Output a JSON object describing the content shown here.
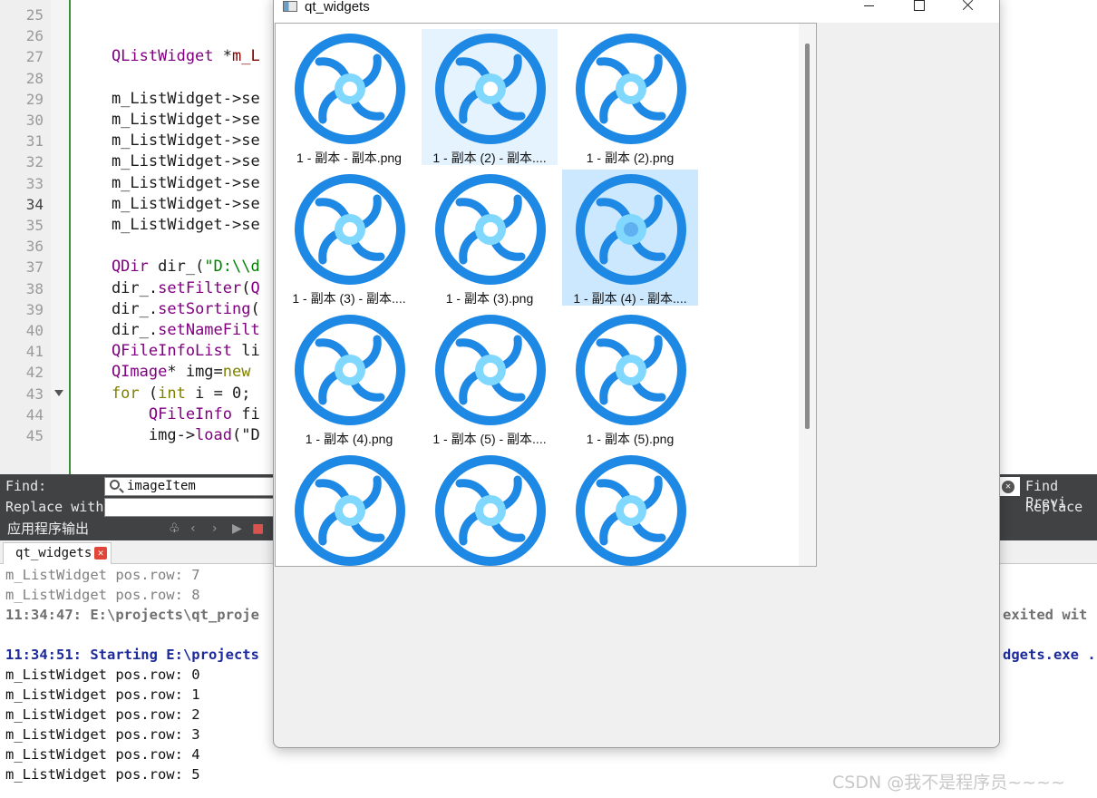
{
  "editor": {
    "lines": [
      {
        "n": "25",
        "segs": []
      },
      {
        "n": "26",
        "segs": []
      },
      {
        "n": "27",
        "segs": [
          {
            "c": "t-type",
            "t": "    QListWidget"
          },
          {
            "c": "",
            "t": " *"
          },
          {
            "c": "t-var",
            "t": "m_L"
          }
        ]
      },
      {
        "n": "28",
        "segs": []
      },
      {
        "n": "29",
        "segs": [
          {
            "c": "",
            "t": "    m_ListWidget->se"
          }
        ]
      },
      {
        "n": "30",
        "segs": [
          {
            "c": "",
            "t": "    m_ListWidget->se"
          }
        ]
      },
      {
        "n": "31",
        "segs": [
          {
            "c": "",
            "t": "    m_ListWidget->se"
          }
        ]
      },
      {
        "n": "32",
        "segs": [
          {
            "c": "",
            "t": "    m_ListWidget->se"
          }
        ]
      },
      {
        "n": "33",
        "segs": [
          {
            "c": "",
            "t": "    m_ListWidget->se"
          }
        ]
      },
      {
        "n": "34",
        "segs": [
          {
            "c": "",
            "t": "    m_ListWidget->se"
          }
        ],
        "current": true
      },
      {
        "n": "35",
        "segs": [
          {
            "c": "",
            "t": "    m_ListWidget->se"
          }
        ]
      },
      {
        "n": "36",
        "segs": []
      },
      {
        "n": "37",
        "segs": [
          {
            "c": "t-type",
            "t": "    QDir"
          },
          {
            "c": "",
            "t": " dir_("
          },
          {
            "c": "t-str",
            "t": "\"D:\\\\d"
          }
        ]
      },
      {
        "n": "38",
        "segs": [
          {
            "c": "",
            "t": "    dir_."
          },
          {
            "c": "t-type",
            "t": "setFilter"
          },
          {
            "c": "",
            "t": "("
          },
          {
            "c": "t-type",
            "t": "Q"
          }
        ]
      },
      {
        "n": "39",
        "segs": [
          {
            "c": "",
            "t": "    dir_."
          },
          {
            "c": "t-type",
            "t": "setSorting"
          },
          {
            "c": "",
            "t": "("
          }
        ]
      },
      {
        "n": "40",
        "segs": [
          {
            "c": "",
            "t": "    dir_."
          },
          {
            "c": "t-type",
            "t": "setNameFilt"
          }
        ]
      },
      {
        "n": "41",
        "segs": [
          {
            "c": "t-type",
            "t": "    QFileInfoList"
          },
          {
            "c": "",
            "t": " li"
          }
        ]
      },
      {
        "n": "42",
        "segs": [
          {
            "c": "t-type",
            "t": "    QImage"
          },
          {
            "c": "",
            "t": "* img="
          },
          {
            "c": "t-kw",
            "t": "new"
          }
        ]
      },
      {
        "n": "43",
        "segs": [
          {
            "c": "t-kw",
            "t": "    for"
          },
          {
            "c": "",
            "t": " ("
          },
          {
            "c": "t-kw",
            "t": "int"
          },
          {
            "c": "",
            "t": " i = 0;"
          }
        ],
        "fold": true
      },
      {
        "n": "44",
        "segs": [
          {
            "c": "t-type",
            "t": "        QFileInfo"
          },
          {
            "c": "",
            "t": " fi"
          }
        ]
      },
      {
        "n": "45",
        "segs": [
          {
            "c": "",
            "t": "        img->"
          },
          {
            "c": "t-type",
            "t": "load"
          },
          {
            "c": "",
            "t": "(\"D"
          }
        ]
      }
    ]
  },
  "findbar": {
    "find_label": "Find:",
    "find_value": "imageItem",
    "replace_label": "Replace with:",
    "find_previous": "Find Previ",
    "replace_button": "Replace"
  },
  "output": {
    "header_title": "应用程序输出",
    "tab_label": "qt_widgets",
    "lines": [
      {
        "cls": "gray",
        "t": "m_ListWidget pos.row: 7"
      },
      {
        "cls": "gray",
        "t": "m_ListWidget pos.row: 8"
      },
      {
        "cls": "boldgray",
        "t": "11:34:47: E:\\projects\\qt_proje"
      },
      {
        "cls": "",
        "t": ""
      },
      {
        "cls": "blue",
        "t": "11:34:51: Starting E:\\projects"
      },
      {
        "cls": "",
        "t": "m_ListWidget pos.row: 0"
      },
      {
        "cls": "",
        "t": "m_ListWidget pos.row: 1"
      },
      {
        "cls": "",
        "t": "m_ListWidget pos.row: 2"
      },
      {
        "cls": "",
        "t": "m_ListWidget pos.row: 3"
      },
      {
        "cls": "",
        "t": "m_ListWidget pos.row: 4"
      },
      {
        "cls": "",
        "t": "m_ListWidget pos.row: 5"
      }
    ],
    "right_exited": "exited wit",
    "right_exe": "dgets.exe ."
  },
  "watermark": "CSDN @我不是程序员~~~~",
  "window": {
    "title": "qt_widgets",
    "items": [
      {
        "label": "1 - 副本 - 副本.png",
        "state": "normal"
      },
      {
        "label": "1 - 副本 (2) - 副本....",
        "state": "hover"
      },
      {
        "label": "1 - 副本 (2).png",
        "state": "normal"
      },
      {
        "label": "1 - 副本 (3) - 副本....",
        "state": "normal"
      },
      {
        "label": "1 - 副本 (3).png",
        "state": "normal"
      },
      {
        "label": "1 - 副本 (4) - 副本....",
        "state": "selected"
      },
      {
        "label": "1 - 副本 (4).png",
        "state": "normal"
      },
      {
        "label": "1 - 副本 (5) - 副本....",
        "state": "normal"
      },
      {
        "label": "1 - 副本 (5).png",
        "state": "normal"
      },
      {
        "label": "",
        "state": "normal"
      },
      {
        "label": "",
        "state": "normal"
      },
      {
        "label": "",
        "state": "normal"
      }
    ]
  },
  "colors": {
    "icon_ring": "#1e88e5",
    "icon_hub": "#80d8ff",
    "selected_bg": "#cce8ff",
    "hover_bg": "#e5f3ff"
  }
}
